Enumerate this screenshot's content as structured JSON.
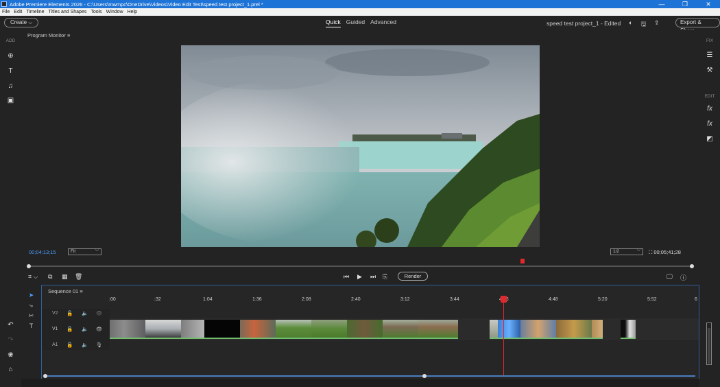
{
  "titlebar": {
    "title": "Adobe Premiere Elements 2026 - C:\\Users\\mwmpc\\OneDrive\\Videos\\Video Edit Test\\speed test project_1.prel *",
    "minimize": "—",
    "restore": "❐",
    "close": "✕"
  },
  "menu": [
    "File",
    "Edit",
    "Timeline",
    "Titles and Shapes",
    "Tools",
    "Window",
    "Help"
  ],
  "topbar": {
    "create_label": "Create",
    "modes": [
      "Quick",
      "Guided",
      "Advanced"
    ],
    "active_mode": "Quick",
    "project_title": "speed test project_1 - Edited",
    "export_label": "Export & Share"
  },
  "left_rail": {
    "add_label": "ADD"
  },
  "right_rail": {
    "fix_label": "FIX",
    "edit_label": "EDIT"
  },
  "program_monitor": {
    "label": "Program Monitor",
    "current_time": "00;04;13;15",
    "fit_option": "Fit",
    "resolution_option": "1/2",
    "duration": "00;05;41;28",
    "render_label": "Render",
    "playhead_fraction": 0.745
  },
  "timeline": {
    "sequence_label": "Sequence 01",
    "ruler_ticks": [
      ":00",
      ":32",
      "1:04",
      "1:36",
      "2:08",
      "2:40",
      "3:12",
      "3:44",
      "4:16",
      "4:48",
      "5:20",
      "5:52"
    ],
    "ruler_tick_partial": "6",
    "tracks": [
      "V2",
      "V1",
      "A1"
    ]
  },
  "colors": {
    "accent_blue": "#1e73d6",
    "playhead_red": "#e0292f",
    "clip_audio_green": "#6fbf6f",
    "timecode_blue": "#4a9fff"
  }
}
